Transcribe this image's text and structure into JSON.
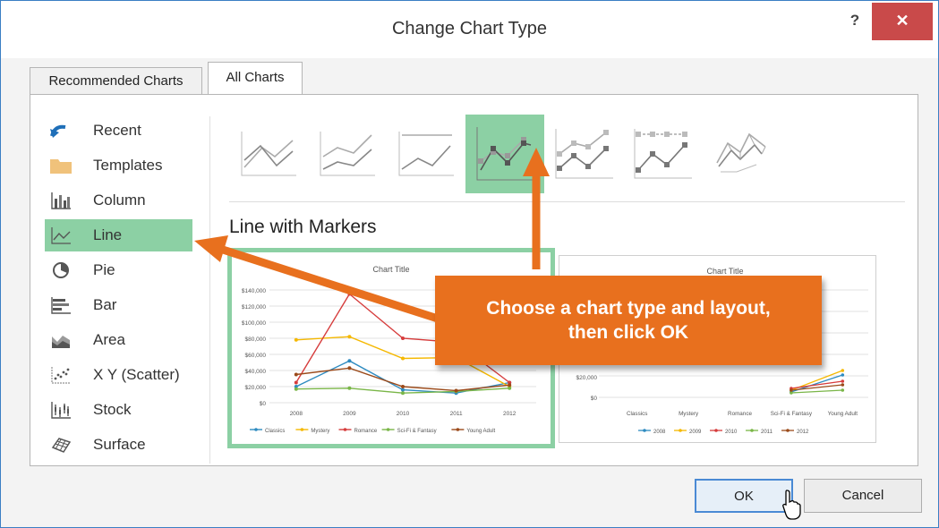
{
  "window": {
    "title": "Change Chart Type",
    "help_label": "?",
    "close_label": "✕"
  },
  "tabs": [
    {
      "label": "Recommended Charts",
      "active": false
    },
    {
      "label": "All Charts",
      "active": true
    }
  ],
  "sidebar": {
    "items": [
      {
        "label": "Recent",
        "icon": "recent-icon"
      },
      {
        "label": "Templates",
        "icon": "folder-icon"
      },
      {
        "label": "Column",
        "icon": "column-chart-icon"
      },
      {
        "label": "Line",
        "icon": "line-chart-icon",
        "selected": true
      },
      {
        "label": "Pie",
        "icon": "pie-chart-icon"
      },
      {
        "label": "Bar",
        "icon": "bar-chart-icon"
      },
      {
        "label": "Area",
        "icon": "area-chart-icon"
      },
      {
        "label": "X Y (Scatter)",
        "icon": "scatter-chart-icon"
      },
      {
        "label": "Stock",
        "icon": "stock-chart-icon"
      },
      {
        "label": "Surface",
        "icon": "surface-chart-icon"
      }
    ]
  },
  "subtypes": {
    "selected_index": 3,
    "selected_label": "Line with Markers"
  },
  "previews": [
    {
      "chart_data": {
        "type": "line",
        "title": "Chart Title",
        "categories": [
          "2008",
          "2009",
          "2010",
          "2011",
          "2012"
        ],
        "y_ticks": [
          "$140,000",
          "$120,000",
          "$100,000",
          "$80,000",
          "$60,000",
          "$40,000",
          "$20,000",
          "$0"
        ],
        "ylim": [
          0,
          140000
        ],
        "series": [
          {
            "name": "Classics",
            "color": "#2e8bc0",
            "values": [
              20000,
              52000,
              16000,
              12000,
              25000
            ]
          },
          {
            "name": "Mystery",
            "color": "#f5b800",
            "values": [
              78000,
              82000,
              55000,
              56000,
              20000
            ]
          },
          {
            "name": "Romance",
            "color": "#d63c3c",
            "values": [
              25000,
              135000,
              80000,
              75000,
              25000
            ]
          },
          {
            "name": "Sci-Fi & Fantasy",
            "color": "#7ab648",
            "values": [
              17000,
              18000,
              12000,
              14000,
              18000
            ]
          },
          {
            "name": "Young Adult",
            "color": "#9b4a1a",
            "values": [
              35000,
              43000,
              20000,
              15000,
              22000
            ]
          }
        ]
      }
    },
    {
      "chart_data": {
        "type": "line",
        "title": "Chart Title",
        "categories": [
          "Classics",
          "Mystery",
          "Romance",
          "Sci-Fi & Fantasy",
          "Young Adult"
        ],
        "y_ticks": [
          "$20,000",
          "$0"
        ],
        "series": [
          {
            "name": "2008",
            "color": "#2e8bc0"
          },
          {
            "name": "2009",
            "color": "#f5b800"
          },
          {
            "name": "2010",
            "color": "#d63c3c"
          },
          {
            "name": "2011",
            "color": "#7ab648"
          },
          {
            "name": "2012",
            "color": "#9b4a1a"
          }
        ]
      }
    }
  ],
  "callout": {
    "line1": "Choose a chart type and layout,",
    "line2": "then click OK"
  },
  "buttons": {
    "ok": "OK",
    "cancel": "Cancel"
  },
  "colors": {
    "accent_green": "#8cd0a4",
    "callout_orange": "#e8701e",
    "close_red": "#c94a4a"
  }
}
